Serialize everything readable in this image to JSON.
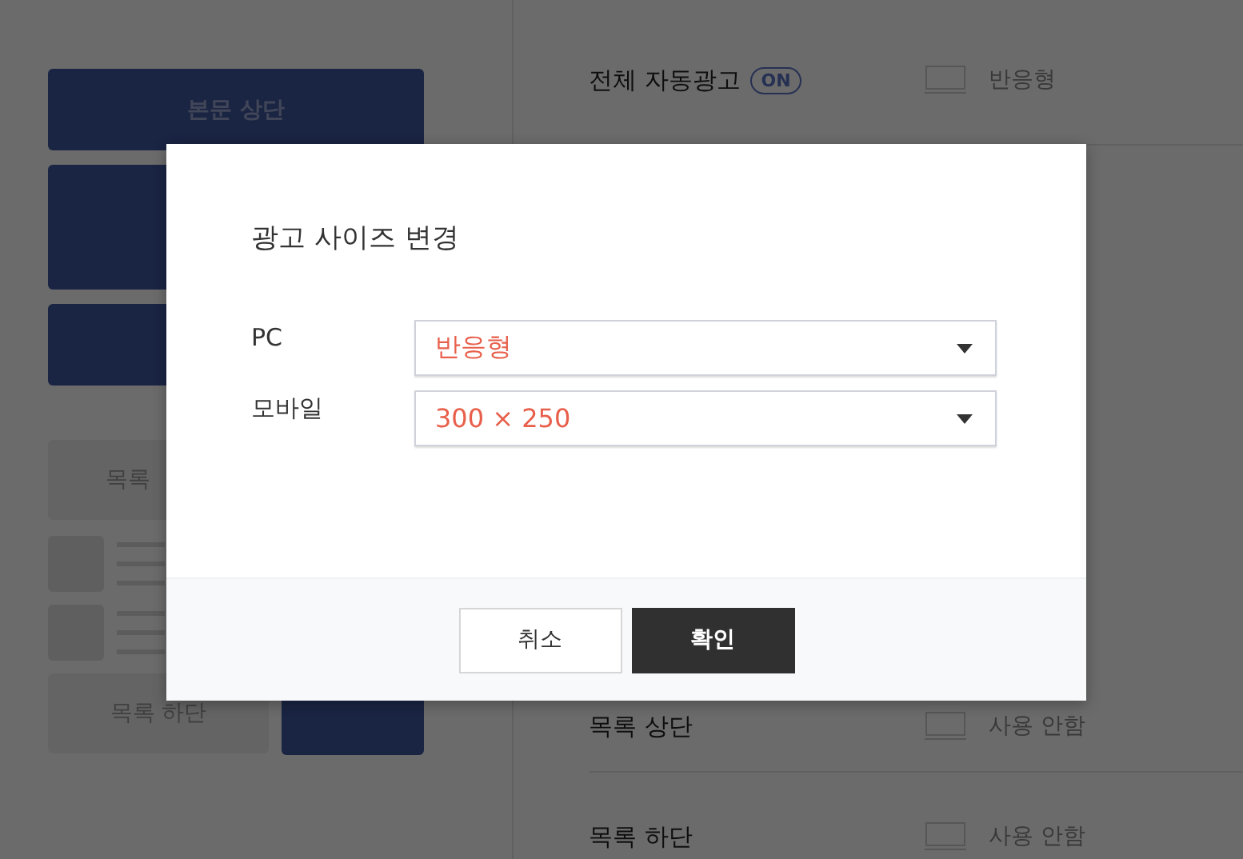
{
  "left_panel": {
    "top_button": "본문 상단",
    "list_top_button": "목록",
    "list_bottom_button": "목록 하단"
  },
  "ad_rows": [
    {
      "label": "전체 자동광고",
      "badge": "ON",
      "option": "반응형"
    },
    {
      "label": "목록 상단",
      "option": "사용 안함"
    },
    {
      "label": "목록 하단",
      "option": "사용 안함"
    }
  ],
  "modal": {
    "title": "광고 사이즈 변경",
    "fields": [
      {
        "label": "PC",
        "value": "반응형"
      },
      {
        "label": "모바일",
        "value": "300 × 250"
      }
    ],
    "buttons": [
      {
        "label": "취소",
        "kind": "secondary"
      },
      {
        "label": "확인",
        "kind": "primary"
      }
    ]
  }
}
